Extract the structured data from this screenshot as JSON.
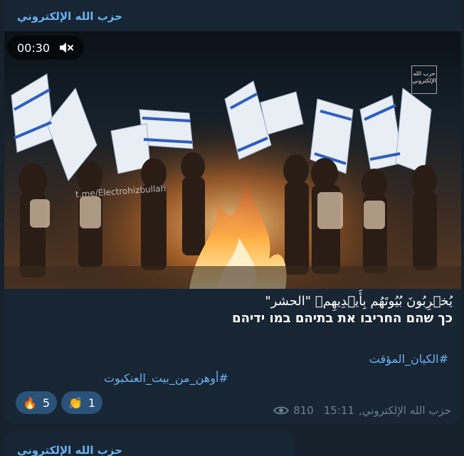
{
  "colors": {
    "background": "#17212b",
    "bubble": "#182533",
    "accent": "#6ab2f2",
    "reaction_bg": "#2b5278",
    "meta_text": "#6d7f8f"
  },
  "post": {
    "sender": "حزب الله الإلكتروني",
    "video": {
      "duration": "00:30",
      "mute_icon": "speaker-muted-icon",
      "watermark": "حزب الله الإلكتروني",
      "channel_handle": "t.me/Electrohizbullah"
    },
    "caption_line1": "يُخۡرِبُونَ بُيُوتَهُم بِأَيۡدِيهِمۡ \"الحشر\"",
    "caption_line2": "כך שהם החריבו את בתיהם במו ידיהם",
    "hashtag1": "#الكيان_المؤقت",
    "hashtag2": "#أوهن_من_بيت_العنكبوت",
    "reactions": [
      {
        "emoji": "🔥",
        "count": "5"
      },
      {
        "emoji": "👏",
        "count": "1"
      }
    ],
    "author_signature": "حزب الله الإلكتروني,",
    "time": "15:11",
    "views": "810",
    "views_icon": "eye-icon"
  },
  "next_post": {
    "sender": "حزب الله الإلكتروني"
  }
}
